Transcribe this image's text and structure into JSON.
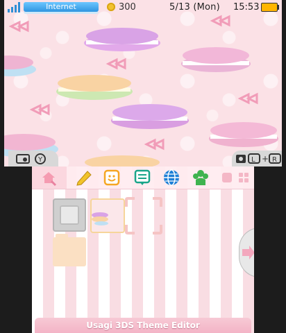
{
  "status_bar": {
    "connection": "Internet",
    "coins": "300",
    "date": "5/13 (Mon)",
    "time": "15:53",
    "battery_color": "#ffb500",
    "signal_icon": "signal-bars-icon"
  },
  "camera_bar": {
    "left_icons": [
      "camera-icon",
      "y-button-icon"
    ],
    "right_icons": [
      "camera-icon",
      "l-button-icon",
      "plus-icon",
      "r-button-icon"
    ]
  },
  "toolbar": {
    "icons": [
      "home-settings-icon",
      "pencil-icon",
      "miiverse-face-icon",
      "notes-icon",
      "internet-browser-icon",
      "friends-list-icon"
    ],
    "right_buttons": [
      "single-view-button",
      "grid-view-button"
    ]
  },
  "theme": {
    "accent": "#f3b4c6",
    "background_stripe_a": "#ffffff",
    "background_stripe_b": "#f9dde3"
  },
  "footer": {
    "label": "Usagi 3DS Theme Editor"
  }
}
